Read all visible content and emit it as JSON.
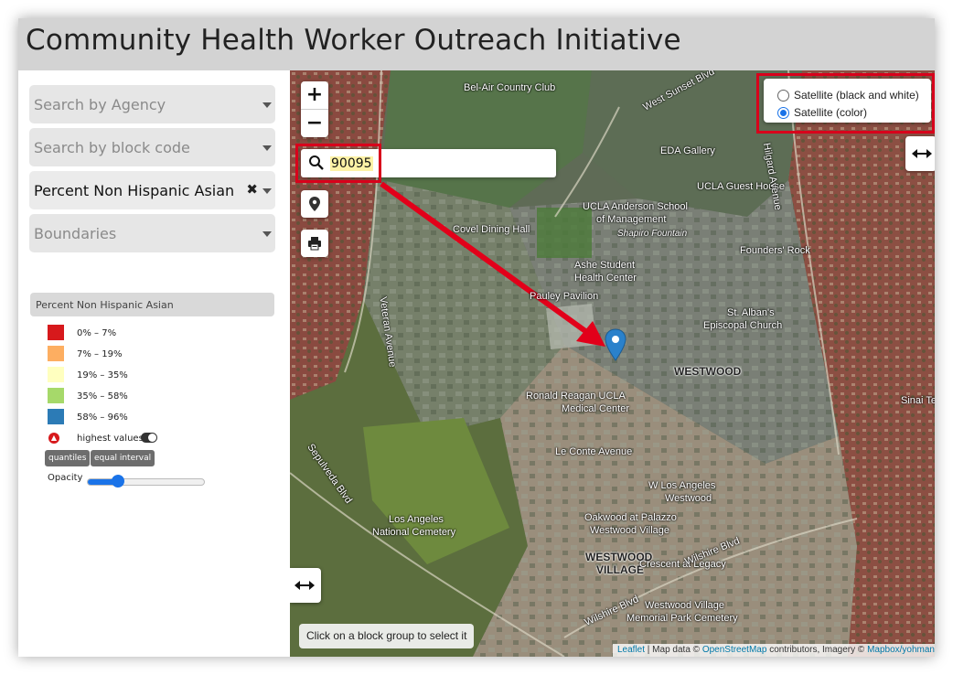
{
  "app": {
    "title": "Community Health Worker Outreach Initiative"
  },
  "sidebar": {
    "filters": [
      {
        "label": "Search by Agency",
        "selected": false
      },
      {
        "label": "Search by block code",
        "selected": false
      },
      {
        "label": "Percent Non Hispanic Asian",
        "selected": true
      },
      {
        "label": "Boundaries",
        "selected": false
      }
    ],
    "legend": {
      "title": "Percent Non Hispanic Asian",
      "items": [
        {
          "label": "0% – 7%",
          "color": "#d7191c"
        },
        {
          "label": "7% – 19%",
          "color": "#fdae61"
        },
        {
          "label": "19% – 35%",
          "color": "#ffffbf"
        },
        {
          "label": "35% – 58%",
          "color": "#a6d96a"
        },
        {
          "label": "58% – 96%",
          "color": "#2c7bb6"
        }
      ],
      "highest_values_label": "highest values",
      "highest_values_on": true,
      "method_buttons": [
        "quantiles",
        "equal interval"
      ],
      "opacity_label": "Opacity",
      "opacity_value": 0.2
    }
  },
  "map": {
    "zoom_in": "+",
    "zoom_out": "−",
    "search_value": "90095",
    "layers": [
      {
        "label": "Satellite (black and white)",
        "checked": false
      },
      {
        "label": "Satellite (color)",
        "checked": true
      }
    ],
    "hint": "Click on a block group to select it",
    "attribution": {
      "leaflet": "Leaflet",
      "sep1": " | Map data © ",
      "osm": "OpenStreetMap",
      "mid": " contributors, Imagery © ",
      "mapbox": "Mapbox/yohman"
    },
    "labels": [
      "Bel-Air Country Club",
      "West Sunset Blvd",
      "EDA Gallery",
      "UCLA Guest House",
      "UCLA Anderson School",
      "of Management",
      "Shapiro Fountain",
      "Covel Dining Hall",
      "Founders' Rock",
      "Ashe Student",
      "Health Center",
      "Pauley Pavilion",
      "St. Alban's",
      "Episcopal Church",
      "WESTWOOD",
      "Ronald Reagan UCLA",
      "Medical Center",
      "Le Conte Avenue",
      "W Los Angeles",
      "Westwood",
      "Los Angeles",
      "National Cemetery",
      "Oakwood at Palazzo",
      "Westwood Village",
      "WESTWOOD",
      "VILLAGE",
      "Crescent at Legacy",
      "Westwood Village",
      "Memorial Park Cemetery",
      "Veteran Avenue",
      "Sepulveda Blvd",
      "Wilshire Blvd",
      "Hilgard Avenue",
      "Wilshire Blvd",
      "Sinai Te"
    ]
  }
}
